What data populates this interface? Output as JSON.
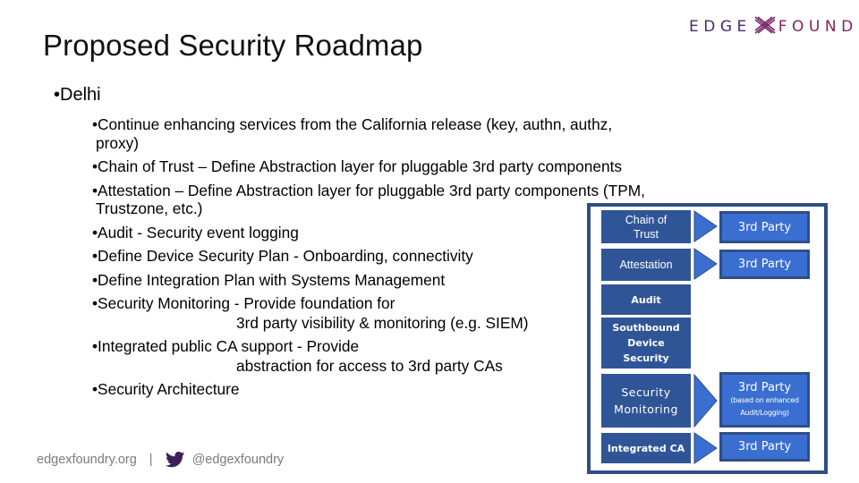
{
  "slide": {
    "title": "Proposed Security Roadmap",
    "logo": {
      "left": "EDGE",
      "mark": "X",
      "right": "FOUNDRY",
      "tm": "™"
    },
    "level1": "•Delhi",
    "bullets": [
      {
        "lines": [
          "•Continue enhancing services from the California release (key, authn, authz,",
          "proxy)"
        ]
      },
      {
        "lines": [
          "•Chain of Trust – Define Abstraction layer for pluggable 3rd party components"
        ]
      },
      {
        "lines": [
          "•Attestation – Define Abstraction layer for pluggable 3rd party components (TPM,",
          "Trustzone, etc.)"
        ]
      },
      {
        "lines": [
          "•Audit - Security event logging"
        ]
      },
      {
        "lines": [
          "•Define Device Security Plan - Onboarding, connectivity"
        ]
      },
      {
        "lines": [
          "•Define Integration Plan with Systems Management"
        ]
      },
      {
        "lines": [
          "•Security Monitoring - Provide foundation for",
          "3rd party visibility & monitoring (e.g. SIEM)"
        ]
      },
      {
        "lines": [
          "•Integrated public CA support - Provide",
          "abstraction for access to 3rd party CAs"
        ]
      },
      {
        "lines": [
          "•Security Architecture"
        ]
      }
    ],
    "footer": {
      "site": "edgexfoundry.org",
      "separator": "|",
      "handle": "@edgexfoundry",
      "icon": "twitter-bird-icon"
    }
  },
  "diagram": {
    "colors": {
      "frame": "#2e4e87",
      "left_box": "#2f5597",
      "right_box": "#3a6fd1",
      "arrow": "#3a6fd1"
    },
    "rows": [
      {
        "component": [
          "Chain of",
          "Trust"
        ],
        "third_party": {
          "label": "3rd Party"
        }
      },
      {
        "component": [
          "Attestation"
        ],
        "third_party": {
          "label": "3rd Party"
        }
      },
      {
        "component": [
          "Audit"
        ],
        "third_party": null
      },
      {
        "component": [
          "Southbound",
          "Device",
          "Security"
        ],
        "third_party": null
      },
      {
        "component": [
          "Security",
          "Monitoring"
        ],
        "third_party": {
          "label": "3rd Party",
          "note": [
            "(based on enhanced",
            "Audit/Logging)"
          ]
        }
      },
      {
        "component": [
          "Integrated CA"
        ],
        "third_party": {
          "label": "3rd Party"
        }
      }
    ]
  }
}
